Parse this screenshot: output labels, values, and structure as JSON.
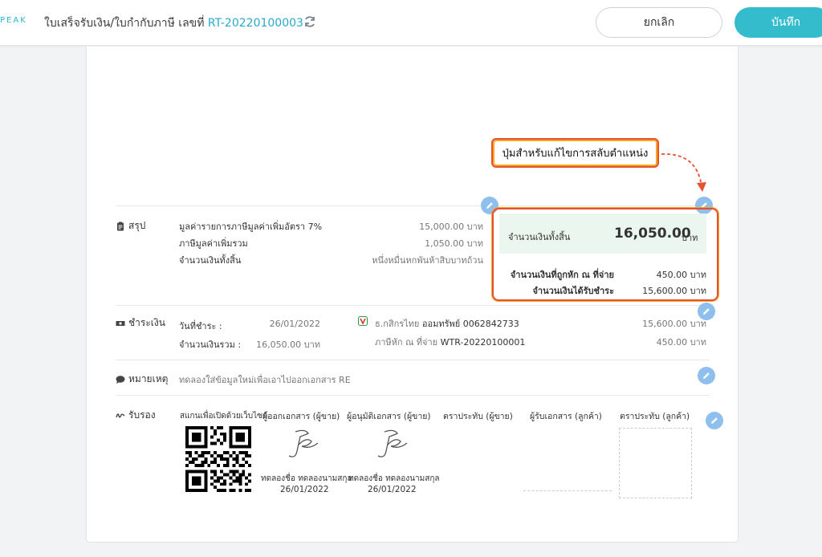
{
  "header": {
    "logo_text": "PEAK",
    "title_prefix": "ใบเสร็จรับเงิน/ใบกำกับภาษี เลขที่ ",
    "doc_number": "RT-20220100003",
    "cancel_label": "ยกเลิก",
    "save_label": "บันทึก"
  },
  "callout": {
    "text": "ปุ่มสำหรับแก้ไขการสลับตำแหน่ง"
  },
  "summary": {
    "label": "สรุป",
    "rows": [
      {
        "label": "มูลค่ารายการภาษีมูลค่าเพิ่มอัตรา 7%",
        "value": "15,000.00 บาท"
      },
      {
        "label": "ภาษีมูลค่าเพิ่มรวม",
        "value": "1,050.00 บาท"
      },
      {
        "label": "จำนวนเงินทั้งสิ้น",
        "value": "หนึ่งหมื่นหกพันห้าสิบบาทถ้วน"
      }
    ],
    "total_label": "จำนวนเงินทั้งสิ้น",
    "total_value": "16,050.00",
    "total_unit": "บาท",
    "withheld_label": "จำนวนเงินที่ถูกหัก ณ ที่จ่าย",
    "withheld_value": "450.00 บาท",
    "received_label": "จำนวนเงินได้รับชำระ",
    "received_value": "15,600.00 บาท"
  },
  "payment": {
    "label": "ชำระเงิน",
    "date_label": "วันที่ชำระ :",
    "date_value": "26/01/2022",
    "amount_label": "จำนวนเงินรวม :",
    "amount_value": "16,050.00 บาท",
    "bank_prefix": "ธ.กสิกรไทย ",
    "bank_account": "ออมทรัพย์ 0062842733",
    "bank_amount": "15,600.00 บาท",
    "wht_prefix": "ภาษีหัก ณ ที่จ่าย ",
    "wht_doc": "WTR-20220100001",
    "wht_amount": "450.00 บาท"
  },
  "note": {
    "label": "หมายเหตุ",
    "text": "ทดลองใส่ข้อมูลใหม่เพื่อเอาไปออกเอกสาร RE"
  },
  "approval": {
    "label": "รับรอง",
    "qr_label": "สแกนเพื่อเปิดด้วยเว็บไซต์",
    "issuer_label": "ผู้ออกเอกสาร (ผู้ขาย)",
    "approver_label": "ผู้อนุมัติเอกสาร (ผู้ขาย)",
    "seller_stamp_label": "ตราประทับ (ผู้ขาย)",
    "receiver_label": "ผู้รับเอกสาร (ลูกค้า)",
    "customer_stamp_label": "ตราประทับ (ลูกค้า)",
    "issuer_name": "ทดลองชื่อ ทดลองนามสกุล",
    "issuer_date": "26/01/2022",
    "approver_name": "ทดลองชื่อ ทดลองนามสกุล",
    "approver_date": "26/01/2022"
  },
  "colors": {
    "accent": "#35bccc",
    "link": "#29a9c9",
    "edit_button": "#8fbfec",
    "callout_border": "#e8512f",
    "total_panel": "#eaf6ee"
  }
}
